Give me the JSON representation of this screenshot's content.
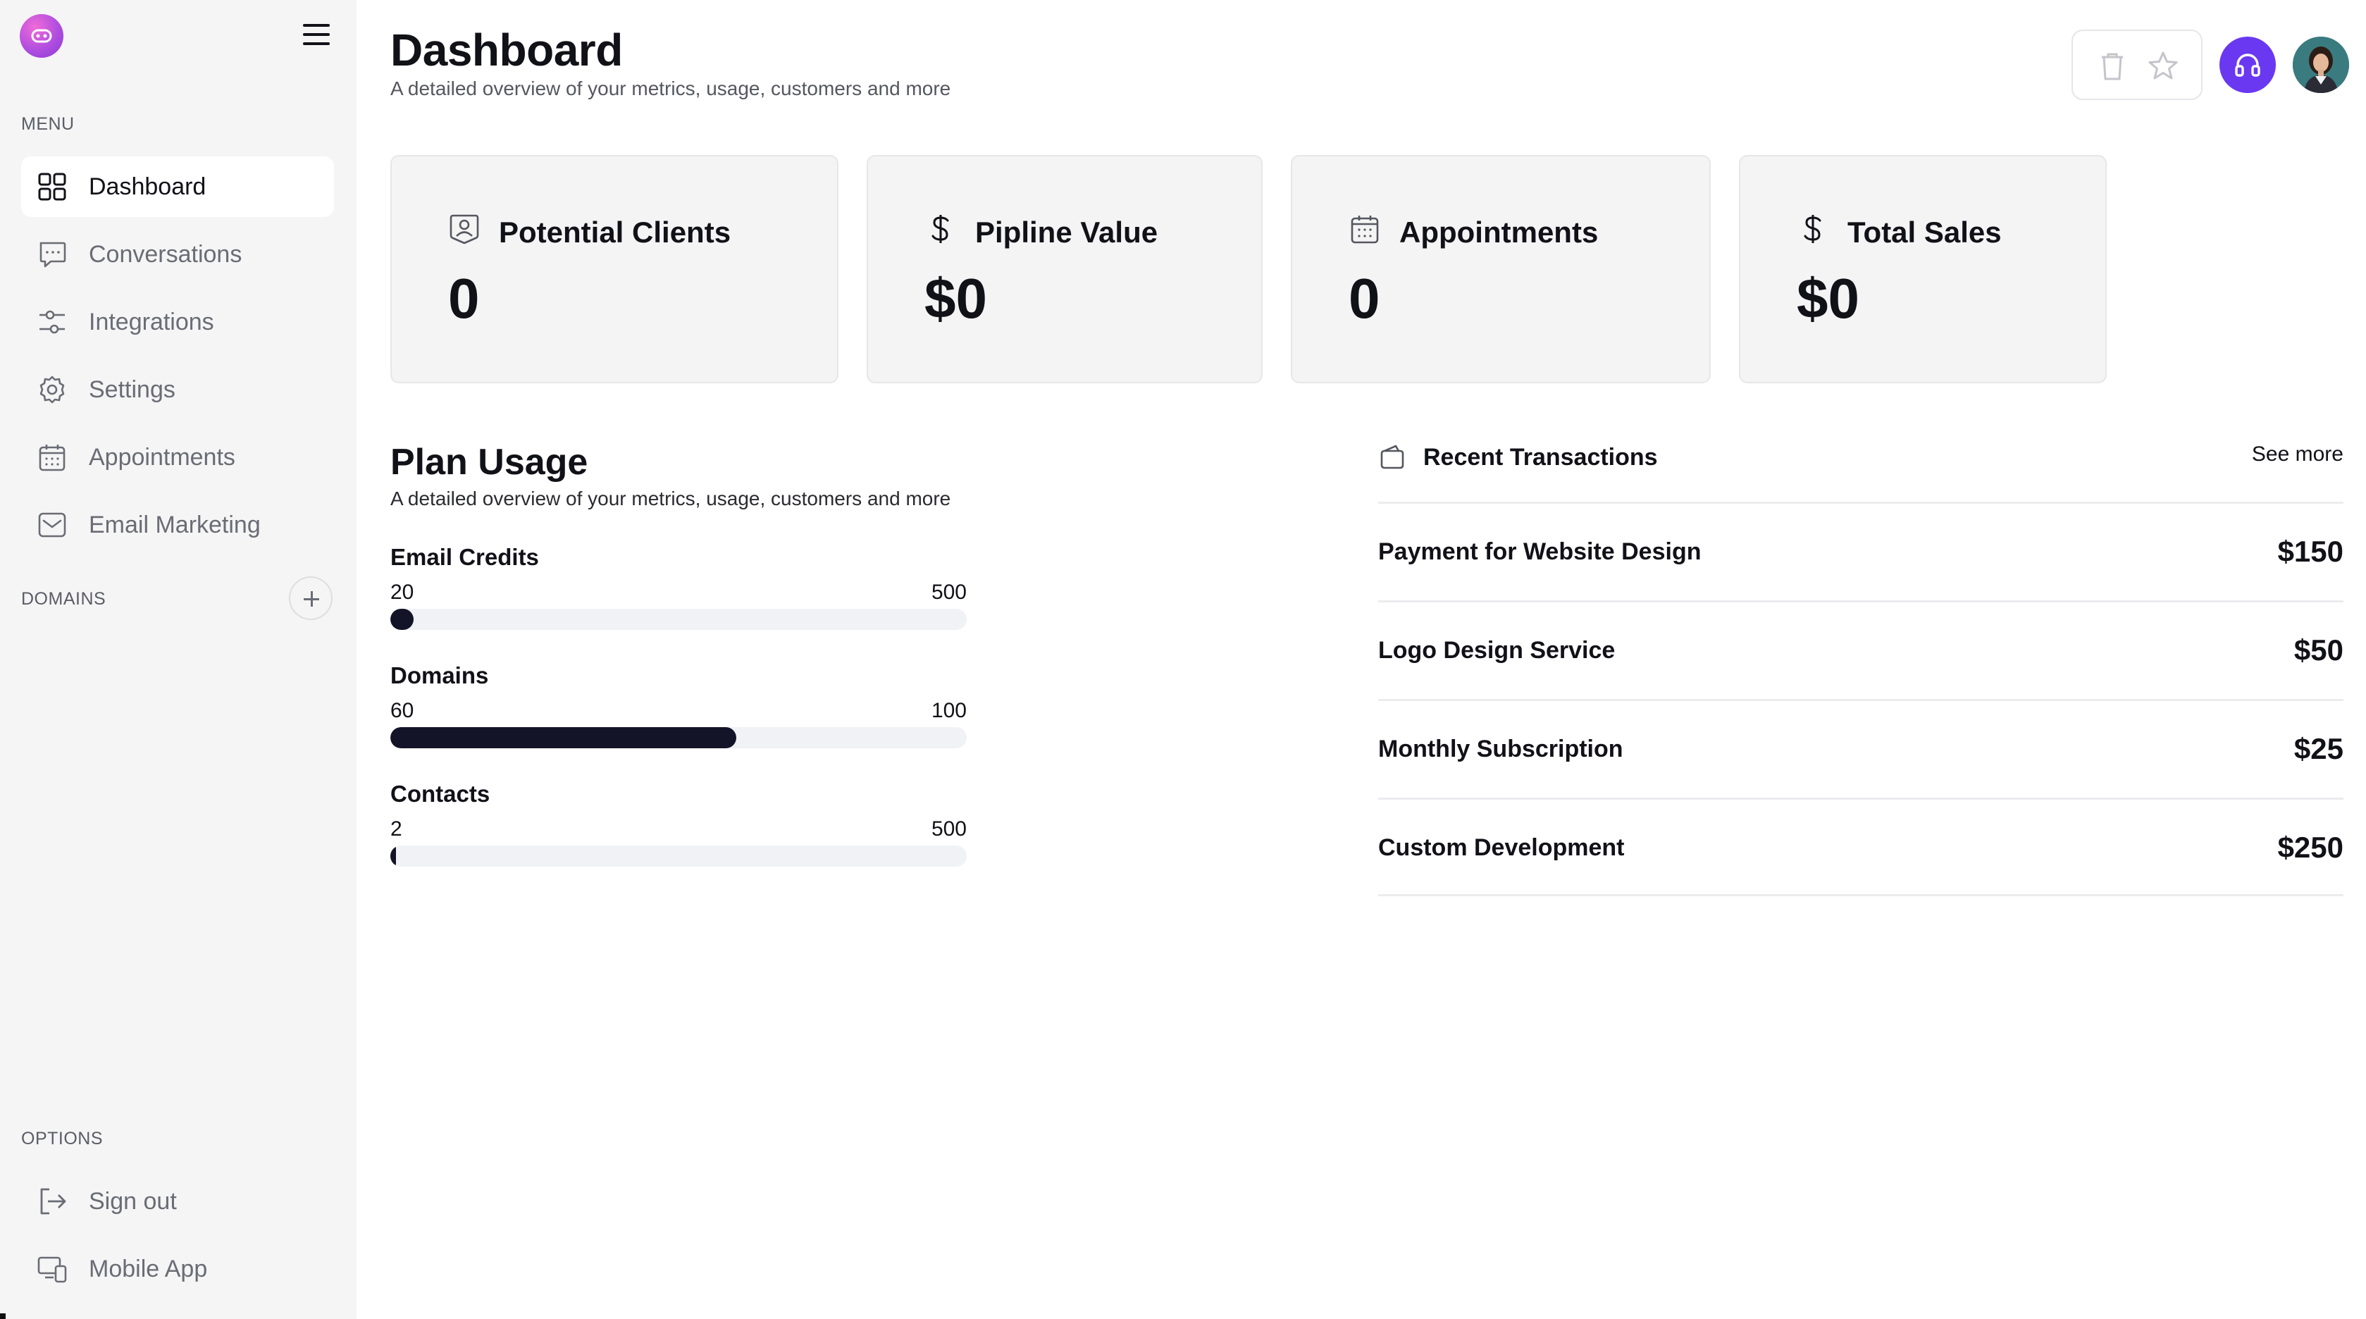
{
  "sidebar": {
    "menu_label": "MENU",
    "items": [
      {
        "label": "Dashboard",
        "icon": "grid-icon",
        "active": true
      },
      {
        "label": "Conversations",
        "icon": "chat-icon"
      },
      {
        "label": "Integrations",
        "icon": "sliders-icon"
      },
      {
        "label": "Settings",
        "icon": "gear-icon"
      },
      {
        "label": "Appointments",
        "icon": "calendar-icon"
      },
      {
        "label": "Email Marketing",
        "icon": "mail-icon"
      }
    ],
    "domains_label": "DOMAINS",
    "options_label": "OPTIONS",
    "options": [
      {
        "label": "Sign out",
        "icon": "sign-out-icon"
      },
      {
        "label": "Mobile App",
        "icon": "devices-icon"
      }
    ]
  },
  "header": {
    "title": "Dashboard",
    "subtitle": "A detailed overview of your metrics, usage, customers and more"
  },
  "cards": [
    {
      "title": "Potential Clients",
      "value": "0",
      "icon": "person-badge-icon"
    },
    {
      "title": "Pipline Value",
      "value": "$0",
      "icon": "dollar-icon"
    },
    {
      "title": "Appointments",
      "value": "0",
      "icon": "calendar-icon"
    },
    {
      "title": "Total Sales",
      "value": "$0",
      "icon": "dollar-icon"
    }
  ],
  "plan_usage": {
    "title": "Plan Usage",
    "subtitle": "A detailed overview of your metrics, usage, customers and more",
    "items": [
      {
        "label": "Email Credits",
        "used": "20",
        "limit": "500",
        "fraction": 0.04
      },
      {
        "label": "Domains",
        "used": "60",
        "limit": "100",
        "fraction": 0.6
      },
      {
        "label": "Contacts",
        "used": "2",
        "limit": "500",
        "fraction": 0.004
      }
    ]
  },
  "transactions": {
    "title": "Recent Transactions",
    "see_more": "See more",
    "rows": [
      {
        "name": "Payment for Website Design",
        "amount": "$150"
      },
      {
        "name": "Logo Design Service",
        "amount": "$50"
      },
      {
        "name": "Monthly Subscription",
        "amount": "$25"
      },
      {
        "name": "Custom Development",
        "amount": "$250"
      }
    ]
  },
  "colors": {
    "accent": "#6a38f0",
    "progress_fill": "#131428",
    "sidebar_bg": "#f5f5f5",
    "card_bg": "#f4f4f5"
  }
}
